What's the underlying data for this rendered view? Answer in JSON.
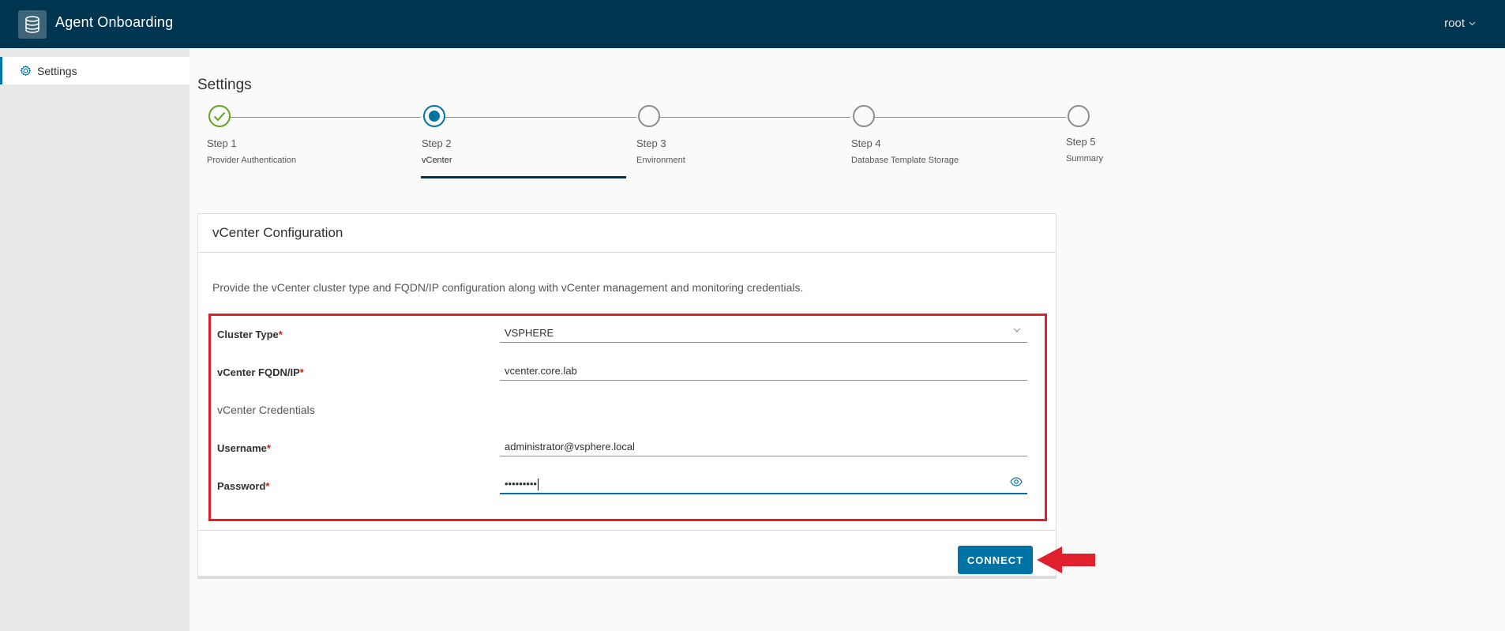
{
  "header": {
    "app_title": "Agent Onboarding",
    "user": "root",
    "logo_icon": "database-icon",
    "background": "#003550"
  },
  "sidebar": {
    "items": [
      {
        "label": "Settings",
        "icon": "gear-icon",
        "active": true
      }
    ]
  },
  "main": {
    "page_title": "Settings",
    "steps": [
      {
        "number": "Step 1",
        "name": "Provider Authentication",
        "status": "complete"
      },
      {
        "number": "Step 2",
        "name": "vCenter",
        "status": "active"
      },
      {
        "number": "Step 3",
        "name": "Environment",
        "status": "pending"
      },
      {
        "number": "Step 4",
        "name": "Database Template Storage",
        "status": "pending"
      },
      {
        "number": "Step 5",
        "name": "Summary",
        "status": "pending"
      }
    ],
    "card": {
      "title": "vCenter Configuration",
      "description": "Provide the vCenter cluster type and FQDN/IP configuration along with vCenter management and monitoring credentials.",
      "fields": {
        "cluster_type": {
          "label": "Cluster Type",
          "value": "VSPHERE"
        },
        "fqdn": {
          "label": "vCenter FQDN/IP",
          "value": "vcenter.core.lab"
        },
        "credentials_section": "vCenter Credentials",
        "username": {
          "label": "Username",
          "value": "administrator@vsphere.local"
        },
        "password": {
          "label": "Password",
          "value": "•••••••••"
        }
      },
      "required_marker": "*",
      "connect_label": "CONNECT"
    }
  },
  "colors": {
    "accent": "#0072a3",
    "complete": "#62a420",
    "highlight": "#e0202c",
    "required": "#c92100"
  }
}
